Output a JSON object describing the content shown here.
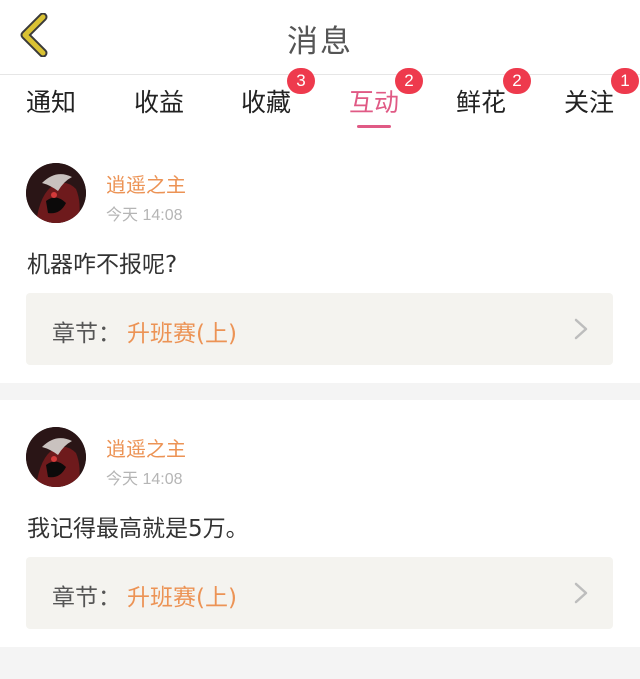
{
  "header": {
    "title": "消息"
  },
  "tabs": [
    {
      "label": "通知",
      "badge": ""
    },
    {
      "label": "收益",
      "badge": ""
    },
    {
      "label": "收藏",
      "badge": "3"
    },
    {
      "label": "互动",
      "badge": "2"
    },
    {
      "label": "鲜花",
      "badge": "2"
    },
    {
      "label": "关注",
      "badge": "1"
    }
  ],
  "active_tab": "互动",
  "messages": [
    {
      "username": "逍遥之主",
      "time": "今天 14:08",
      "text": "机器咋不报呢?",
      "chapter_prefix": "章节：",
      "chapter_name": "升班赛(上)"
    },
    {
      "username": "逍遥之主",
      "time": "今天 14:08",
      "text": "我记得最高就是5万。",
      "chapter_prefix": "章节：",
      "chapter_name": "升班赛(上)"
    }
  ],
  "colors": {
    "accent_pink": "#e05a85",
    "username_orange": "#ec9355",
    "badge_red": "#ee3a4d",
    "back_arrow_yellow": "#d9c233"
  },
  "icons": {
    "back": "chevron-left-icon",
    "chapter_arrow": "chevron-right-icon"
  }
}
